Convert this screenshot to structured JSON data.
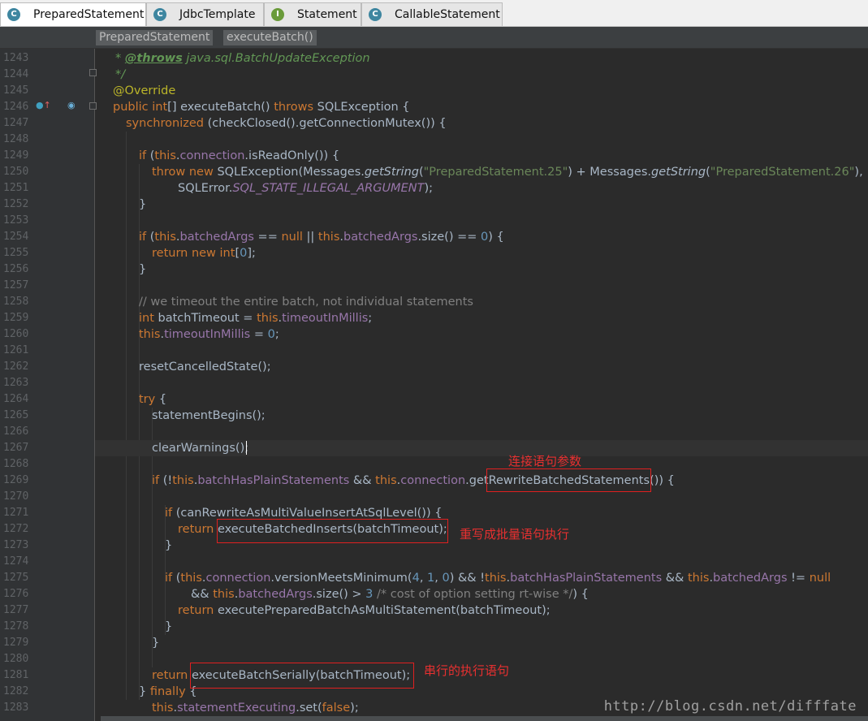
{
  "tabs": [
    {
      "label": "PreparedStatement",
      "icon": "class-icon",
      "glyph": "C",
      "active": true
    },
    {
      "label": "JdbcTemplate",
      "icon": "class-icon",
      "glyph": "C",
      "active": false
    },
    {
      "label": "Statement",
      "icon": "interface-icon",
      "glyph": "I",
      "active": false
    },
    {
      "label": "CallableStatement",
      "icon": "class-icon",
      "glyph": "C",
      "active": false
    }
  ],
  "breadcrumb": [
    "PreparedStatement",
    "executeBatch()"
  ],
  "editor": {
    "line_numbers": [
      "1243",
      "1244",
      "1245",
      "1246",
      "1247",
      "1248",
      "1249",
      "1250",
      "1251",
      "1252",
      "1253",
      "1254",
      "1255",
      "1256",
      "1257",
      "1258",
      "1259",
      "1260",
      "1261",
      "1262",
      "1263",
      "1264",
      "1265",
      "1266",
      "1267",
      "1268",
      "1269",
      "1270",
      "1271",
      "1272",
      "1273",
      "1274",
      "1275",
      "1276",
      "1277",
      "1278",
      "1279",
      "1280",
      "1281",
      "1282",
      "1283"
    ],
    "lines": [
      [
        {
          "t": "* ",
          "c": "dochead"
        },
        {
          "t": "@throws",
          "c": "doctag"
        },
        {
          "t": " java.sql.BatchUpdateException",
          "c": "dochead"
        }
      ],
      [
        {
          "t": "*/",
          "c": "dochead"
        }
      ],
      [
        {
          "t": "@Override",
          "c": "ann"
        }
      ],
      [
        {
          "t": "public ",
          "c": "kw"
        },
        {
          "t": "int",
          "c": "kw"
        },
        {
          "t": "[] "
        },
        {
          "t": "executeBatch",
          "c": "fn"
        },
        {
          "t": "() "
        },
        {
          "t": "throws ",
          "c": "kw"
        },
        {
          "t": "SQLException {"
        }
      ],
      [
        {
          "t": "synchronized ",
          "c": "kw"
        },
        {
          "t": "(checkClosed().getConnectionMutex()) {"
        }
      ],
      [],
      [
        {
          "t": "if ",
          "c": "kw"
        },
        {
          "t": "("
        },
        {
          "t": "this",
          "c": "kw"
        },
        {
          "t": "."
        },
        {
          "t": "connection",
          "c": "fld"
        },
        {
          "t": ".isReadOnly()) {"
        }
      ],
      [
        {
          "t": "throw new ",
          "c": "kw"
        },
        {
          "t": "SQLException(Messages."
        },
        {
          "t": "getString",
          "c": "it"
        },
        {
          "t": "("
        },
        {
          "t": "\"PreparedStatement.25\"",
          "c": "str"
        },
        {
          "t": ") + Messages."
        },
        {
          "t": "getString",
          "c": "it"
        },
        {
          "t": "("
        },
        {
          "t": "\"PreparedStatement.26\"",
          "c": "str"
        },
        {
          "t": "),"
        }
      ],
      [
        {
          "t": "SQLError."
        },
        {
          "t": "SQL_STATE_ILLEGAL_ARGUMENT",
          "c": "fld it"
        },
        {
          "t": ");"
        }
      ],
      [
        {
          "t": "}"
        }
      ],
      [],
      [
        {
          "t": "if ",
          "c": "kw"
        },
        {
          "t": "("
        },
        {
          "t": "this",
          "c": "kw"
        },
        {
          "t": "."
        },
        {
          "t": "batchedArgs",
          "c": "fld"
        },
        {
          "t": " == "
        },
        {
          "t": "null ",
          "c": "kw"
        },
        {
          "t": "|| "
        },
        {
          "t": "this",
          "c": "kw"
        },
        {
          "t": "."
        },
        {
          "t": "batchedArgs",
          "c": "fld"
        },
        {
          "t": ".size() == "
        },
        {
          "t": "0",
          "c": "num"
        },
        {
          "t": ") {"
        }
      ],
      [
        {
          "t": "return new ",
          "c": "kw"
        },
        {
          "t": "int",
          "c": "kw"
        },
        {
          "t": "["
        },
        {
          "t": "0",
          "c": "num"
        },
        {
          "t": "];"
        }
      ],
      [
        {
          "t": "}"
        }
      ],
      [],
      [
        {
          "t": "// we timeout the entire batch, not individual statements",
          "c": "cm"
        }
      ],
      [
        {
          "t": "int ",
          "c": "kw"
        },
        {
          "t": "batchTimeout = "
        },
        {
          "t": "this",
          "c": "kw"
        },
        {
          "t": "."
        },
        {
          "t": "timeoutInMillis",
          "c": "fld"
        },
        {
          "t": ";"
        }
      ],
      [
        {
          "t": "this",
          "c": "kw"
        },
        {
          "t": "."
        },
        {
          "t": "timeoutInMillis",
          "c": "fld"
        },
        {
          "t": " = "
        },
        {
          "t": "0",
          "c": "num"
        },
        {
          "t": ";"
        }
      ],
      [],
      [
        {
          "t": "resetCancelledState();"
        }
      ],
      [],
      [
        {
          "t": "try ",
          "c": "kw"
        },
        {
          "t": "{"
        }
      ],
      [
        {
          "t": "statementBegins();"
        }
      ],
      [],
      [
        {
          "t": "clearWarnings();"
        }
      ],
      [],
      [
        {
          "t": "if ",
          "c": "kw"
        },
        {
          "t": "(!"
        },
        {
          "t": "this",
          "c": "kw"
        },
        {
          "t": "."
        },
        {
          "t": "batchHasPlainStatements",
          "c": "fld"
        },
        {
          "t": " && "
        },
        {
          "t": "this",
          "c": "kw"
        },
        {
          "t": "."
        },
        {
          "t": "connection",
          "c": "fld"
        },
        {
          "t": ".getRewriteBatchedStatements()) {"
        }
      ],
      [],
      [
        {
          "t": "if ",
          "c": "kw"
        },
        {
          "t": "(canRewriteAsMultiValueInsertAtSqlLevel()) {"
        }
      ],
      [
        {
          "t": "return ",
          "c": "kw"
        },
        {
          "t": "executeBatchedInserts(batchTimeout);"
        }
      ],
      [
        {
          "t": "}"
        }
      ],
      [],
      [
        {
          "t": "if ",
          "c": "kw"
        },
        {
          "t": "("
        },
        {
          "t": "this",
          "c": "kw"
        },
        {
          "t": "."
        },
        {
          "t": "connection",
          "c": "fld"
        },
        {
          "t": ".versionMeetsMinimum("
        },
        {
          "t": "4",
          "c": "num"
        },
        {
          "t": ", "
        },
        {
          "t": "1",
          "c": "num"
        },
        {
          "t": ", "
        },
        {
          "t": "0",
          "c": "num"
        },
        {
          "t": ") && !"
        },
        {
          "t": "this",
          "c": "kw"
        },
        {
          "t": "."
        },
        {
          "t": "batchHasPlainStatements",
          "c": "fld"
        },
        {
          "t": " && "
        },
        {
          "t": "this",
          "c": "kw"
        },
        {
          "t": "."
        },
        {
          "t": "batchedArgs",
          "c": "fld"
        },
        {
          "t": " != "
        },
        {
          "t": "null",
          "c": "kw"
        }
      ],
      [
        {
          "t": "&& "
        },
        {
          "t": "this",
          "c": "kw"
        },
        {
          "t": "."
        },
        {
          "t": "batchedArgs",
          "c": "fld"
        },
        {
          "t": ".size() > "
        },
        {
          "t": "3 ",
          "c": "num"
        },
        {
          "t": "/* cost of option setting rt-wise */",
          "c": "cm"
        },
        {
          "t": ") {"
        }
      ],
      [
        {
          "t": "return ",
          "c": "kw"
        },
        {
          "t": "executePreparedBatchAsMultiStatement(batchTimeout);"
        }
      ],
      [
        {
          "t": "}"
        }
      ],
      [
        {
          "t": "}"
        }
      ],
      [],
      [
        {
          "t": "return ",
          "c": "kw"
        },
        {
          "t": "executeBatchSerially(batchTimeout);"
        }
      ],
      [
        {
          "t": "} "
        },
        {
          "t": "finally ",
          "c": "kw"
        },
        {
          "t": "{"
        }
      ],
      [
        {
          "t": "this",
          "c": "kw"
        },
        {
          "t": "."
        },
        {
          "t": "statementExecuting",
          "c": "fld"
        },
        {
          "t": ".set("
        },
        {
          "t": "false",
          "c": "kw"
        },
        {
          "t": ");"
        }
      ]
    ]
  },
  "annotations": {
    "note1": "连接语句参数",
    "note2": "重写成批量语句执行",
    "note3": "串行的执行语句"
  },
  "watermark": "http://blog.csdn.net/difffate",
  "colors": {
    "keyword": "#cc7832",
    "field": "#9876aa",
    "string": "#6a8759",
    "number": "#6897bb",
    "comment": "#808080",
    "annotation_red": "#e02020"
  }
}
